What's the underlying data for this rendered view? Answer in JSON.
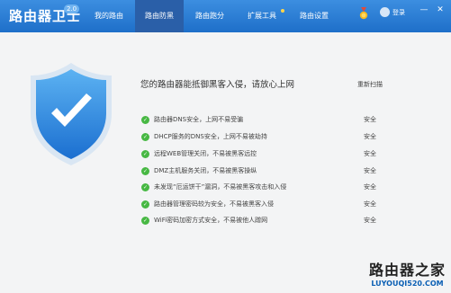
{
  "app": {
    "title": "路由器卫士",
    "version": "2.0"
  },
  "tabs": [
    {
      "label": "我的路由",
      "active": false
    },
    {
      "label": "路由防黑",
      "active": true
    },
    {
      "label": "路由跑分",
      "active": false
    },
    {
      "label": "扩展工具",
      "active": false,
      "badge": true
    },
    {
      "label": "路由设置",
      "active": false
    }
  ],
  "account": {
    "login_label": "登录"
  },
  "window_controls": {
    "minimize": "—",
    "close": "✕"
  },
  "main": {
    "headline": "您的路由器能抵御黑客入侵，请放心上网",
    "rescan_label": "重新扫描",
    "items": [
      {
        "text": "路由器DNS安全，上网不易受骗",
        "status": "安全"
      },
      {
        "text": "DHCP服务的DNS安全，上网不易被劫持",
        "status": "安全"
      },
      {
        "text": "远程WEB管理关闭，不易被黑客远控",
        "status": "安全"
      },
      {
        "text": "DMZ主机服务关闭，不易被黑客操纵",
        "status": "安全"
      },
      {
        "text": "未发现“厄运饼干”漏洞，不易被黑客攻击和入侵",
        "status": "安全"
      },
      {
        "text": "路由器管理密码较为安全，不易被黑客入侵",
        "status": "安全"
      },
      {
        "text": "WiFi密码加密方式安全，不易被他人蹭网",
        "status": "安全"
      }
    ]
  },
  "watermark": {
    "title": "路由器之家",
    "url": "LUYOUQI520.COM"
  },
  "colors": {
    "titlebar": "#1e6fc9",
    "active_tab": "#2a5fa8",
    "check": "#47b843",
    "shield": "#2d8fe0"
  }
}
